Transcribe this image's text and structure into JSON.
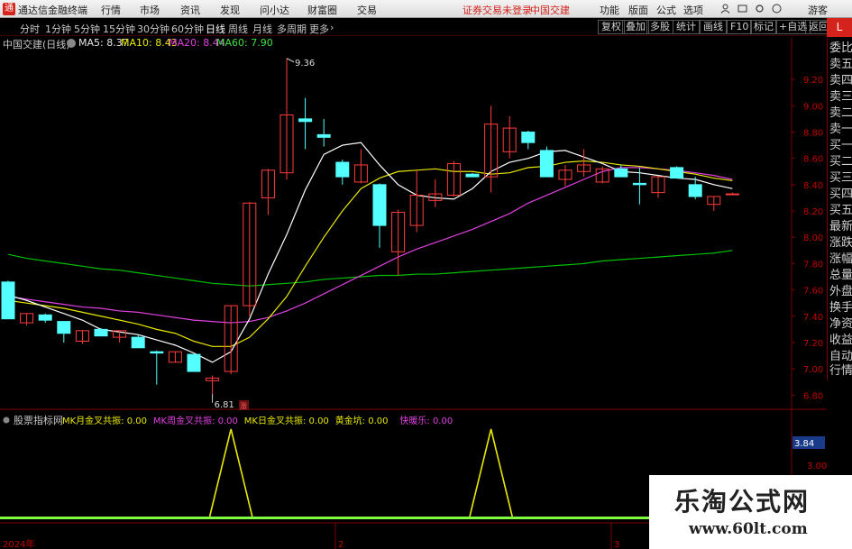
{
  "app": {
    "title": "通达信金融终端",
    "logo_char": "通"
  },
  "top_menu": {
    "items": [
      "行情",
      "市场",
      "资讯",
      "发现",
      "问小达",
      "财富圈",
      "交易"
    ],
    "status_text": "证券交易未登录",
    "stock_name": "中国交建",
    "right_items": [
      "功能",
      "版面",
      "公式",
      "选项"
    ],
    "guest": "游客"
  },
  "period_toolbar": {
    "items": [
      "分时",
      "1分钟",
      "5分钟",
      "15分钟",
      "30分钟",
      "60分钟",
      "日线",
      "周线",
      "月线",
      "多周期",
      "更多"
    ],
    "active": "日线",
    "right_buttons": [
      "复权",
      "叠加",
      "多股",
      "统计",
      "画线",
      "F10",
      "标记",
      "+自选",
      "返回"
    ]
  },
  "main_header": {
    "title": "中国交建(日线)",
    "ma5": "MA5: 8.37",
    "ma10": "MA10: 8.43",
    "ma20": "MA20: 8.44",
    "ma60": "MA60: 7.90"
  },
  "price_labels": [
    "9.20",
    "9.00",
    "8.80",
    "8.60",
    "8.40",
    "8.20",
    "8.00",
    "7.80",
    "7.60",
    "7.40",
    "7.20",
    "7.00",
    "6.80"
  ],
  "high_label": "9.36",
  "low_label": "6.81",
  "marker_char": "涨",
  "right_panel": {
    "corner": "L",
    "items": [
      "委比",
      "卖五",
      "卖四",
      "卖三",
      "卖二",
      "卖一",
      "买一",
      "买二",
      "买三",
      "买四",
      "买五",
      "最新",
      "涨跌",
      "涨幅",
      "总量",
      "外盘",
      "换手",
      "净资",
      "收益",
      "自动",
      "行情"
    ]
  },
  "sub_header": {
    "title": "股票指标网",
    "items": [
      {
        "label": "MK月金叉共振: 0.00",
        "color": "#e8e800"
      },
      {
        "label": "MK周金叉共振: 0.00",
        "color": "#e040e0"
      },
      {
        "label": "MK日金叉共振: 0.00",
        "color": "#e8e800"
      },
      {
        "label": "黄金坑: 0.00",
        "color": "#e8e800"
      },
      {
        "label": "快暖乐: 0.00",
        "color": "#e040e0"
      }
    ]
  },
  "sub_axis": {
    "highlight": "3.84",
    "label": "3.00"
  },
  "x_axis": {
    "labels": [
      "2024年",
      "2",
      "3"
    ]
  },
  "watermark": {
    "title": "乐淘公式网",
    "url": "www.60lt.com"
  },
  "chart_data": {
    "type": "candlestick",
    "y_range": [
      6.72,
      9.42
    ],
    "candles": [
      {
        "o": 7.66,
        "h": 7.67,
        "l": 7.38,
        "c": 7.38
      },
      {
        "o": 7.35,
        "h": 7.42,
        "l": 7.33,
        "c": 7.42
      },
      {
        "o": 7.41,
        "h": 7.42,
        "l": 7.35,
        "c": 7.37
      },
      {
        "o": 7.36,
        "h": 7.36,
        "l": 7.2,
        "c": 7.27
      },
      {
        "o": 7.21,
        "h": 7.29,
        "l": 7.19,
        "c": 7.29
      },
      {
        "o": 7.3,
        "h": 7.31,
        "l": 7.25,
        "c": 7.25
      },
      {
        "o": 7.24,
        "h": 7.29,
        "l": 7.2,
        "c": 7.29
      },
      {
        "o": 7.24,
        "h": 7.26,
        "l": 7.16,
        "c": 7.16
      },
      {
        "o": 7.13,
        "h": 7.14,
        "l": 6.88,
        "c": 7.12
      },
      {
        "o": 7.05,
        "h": 7.13,
        "l": 7.05,
        "c": 7.13
      },
      {
        "o": 7.11,
        "h": 7.11,
        "l": 6.98,
        "c": 6.98
      },
      {
        "o": 6.91,
        "h": 6.95,
        "l": 6.81,
        "c": 6.93
      },
      {
        "o": 6.98,
        "h": 7.48,
        "l": 6.96,
        "c": 7.48
      },
      {
        "o": 7.48,
        "h": 8.27,
        "l": 7.4,
        "c": 8.26
      },
      {
        "o": 8.3,
        "h": 8.52,
        "l": 8.17,
        "c": 8.51
      },
      {
        "o": 8.49,
        "h": 9.36,
        "l": 8.44,
        "c": 8.93
      },
      {
        "o": 8.9,
        "h": 9.06,
        "l": 8.67,
        "c": 8.88
      },
      {
        "o": 8.78,
        "h": 8.9,
        "l": 8.69,
        "c": 8.76
      },
      {
        "o": 8.57,
        "h": 8.59,
        "l": 8.4,
        "c": 8.46
      },
      {
        "o": 8.42,
        "h": 8.67,
        "l": 8.41,
        "c": 8.55
      },
      {
        "o": 8.4,
        "h": 8.41,
        "l": 7.92,
        "c": 8.09
      },
      {
        "o": 7.89,
        "h": 8.21,
        "l": 7.71,
        "c": 8.19
      },
      {
        "o": 8.09,
        "h": 8.51,
        "l": 8.04,
        "c": 8.32
      },
      {
        "o": 8.28,
        "h": 8.44,
        "l": 8.23,
        "c": 8.33
      },
      {
        "o": 8.32,
        "h": 8.58,
        "l": 8.31,
        "c": 8.56
      },
      {
        "o": 8.48,
        "h": 8.49,
        "l": 8.46,
        "c": 8.46
      },
      {
        "o": 8.46,
        "h": 9.0,
        "l": 8.34,
        "c": 8.86
      },
      {
        "o": 8.65,
        "h": 8.92,
        "l": 8.6,
        "c": 8.83
      },
      {
        "o": 8.8,
        "h": 8.81,
        "l": 8.67,
        "c": 8.72
      },
      {
        "o": 8.66,
        "h": 8.69,
        "l": 8.46,
        "c": 8.46
      },
      {
        "o": 8.44,
        "h": 8.55,
        "l": 8.39,
        "c": 8.51
      },
      {
        "o": 8.5,
        "h": 8.67,
        "l": 8.46,
        "c": 8.55
      },
      {
        "o": 8.42,
        "h": 8.54,
        "l": 8.41,
        "c": 8.52
      },
      {
        "o": 8.52,
        "h": 8.55,
        "l": 8.46,
        "c": 8.46
      },
      {
        "o": 8.41,
        "h": 8.53,
        "l": 8.25,
        "c": 8.4
      },
      {
        "o": 8.34,
        "h": 8.46,
        "l": 8.3,
        "c": 8.46
      },
      {
        "o": 8.53,
        "h": 8.54,
        "l": 8.45,
        "c": 8.45
      },
      {
        "o": 8.4,
        "h": 8.46,
        "l": 8.29,
        "c": 8.31
      },
      {
        "o": 8.25,
        "h": 8.31,
        "l": 8.2,
        "c": 8.31
      },
      {
        "o": 8.33,
        "h": 8.34,
        "l": 8.32,
        "c": 8.33
      }
    ],
    "ma5": [
      7.56,
      7.52,
      7.47,
      7.42,
      7.37,
      7.3,
      7.28,
      7.26,
      7.22,
      7.18,
      7.12,
      7.05,
      7.13,
      7.38,
      7.72,
      8.02,
      8.36,
      8.63,
      8.7,
      8.72,
      8.55,
      8.4,
      8.32,
      8.3,
      8.29,
      8.37,
      8.5,
      8.57,
      8.6,
      8.65,
      8.66,
      8.61,
      8.56,
      8.5,
      8.49,
      8.47,
      8.45,
      8.44,
      8.4,
      8.37
    ],
    "ma10": [
      7.52,
      7.5,
      7.48,
      7.46,
      7.43,
      7.4,
      7.37,
      7.34,
      7.3,
      7.27,
      7.21,
      7.17,
      7.17,
      7.24,
      7.38,
      7.55,
      7.78,
      8.0,
      8.2,
      8.37,
      8.45,
      8.5,
      8.51,
      8.52,
      8.5,
      8.5,
      8.48,
      8.49,
      8.53,
      8.54,
      8.57,
      8.58,
      8.57,
      8.55,
      8.54,
      8.52,
      8.5,
      8.48,
      8.45,
      8.43
    ],
    "ma20": [
      7.55,
      7.53,
      7.51,
      7.49,
      7.47,
      7.46,
      7.44,
      7.43,
      7.41,
      7.39,
      7.37,
      7.36,
      7.35,
      7.36,
      7.39,
      7.44,
      7.5,
      7.57,
      7.64,
      7.71,
      7.78,
      7.85,
      7.91,
      7.96,
      8.01,
      8.06,
      8.12,
      8.18,
      8.26,
      8.32,
      8.38,
      8.44,
      8.5,
      8.53,
      8.53,
      8.52,
      8.51,
      8.49,
      8.47,
      8.44
    ],
    "ma60": [
      7.87,
      7.84,
      7.82,
      7.8,
      7.78,
      7.76,
      7.75,
      7.73,
      7.71,
      7.69,
      7.67,
      7.65,
      7.64,
      7.63,
      7.64,
      7.65,
      7.66,
      7.68,
      7.69,
      7.7,
      7.71,
      7.71,
      7.72,
      7.72,
      7.73,
      7.74,
      7.75,
      7.76,
      7.77,
      7.78,
      7.79,
      7.8,
      7.82,
      7.83,
      7.84,
      7.85,
      7.86,
      7.87,
      7.88,
      7.9
    ],
    "signals": [
      {
        "start": 11,
        "peak": 12,
        "end": 13
      },
      {
        "start": 25,
        "peak": 26,
        "end": 27
      }
    ],
    "colors": {
      "up": "#ff3c3c",
      "down": "#54ffff",
      "ma5": "#ffffff",
      "ma10": "#e8e800",
      "ma20": "#e040e0",
      "ma60": "#00c000",
      "signal": "#e8e800",
      "baseline": "#80ff40",
      "grid": "#800000",
      "axis_text": "#c00000"
    }
  }
}
